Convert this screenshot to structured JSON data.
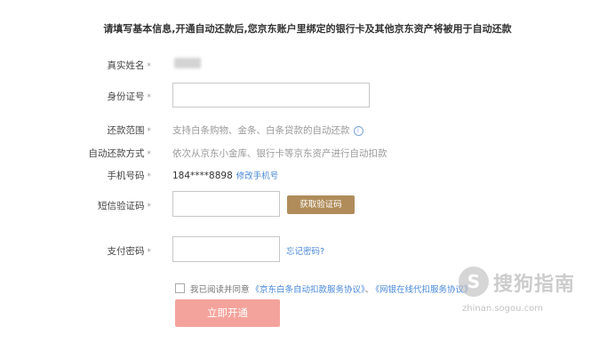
{
  "notice": "请填写基本信息,开通自动还款后,您京东账户里绑定的银行卡及其他京东资产将被用于自动还款",
  "form": {
    "name_label": "真实姓名",
    "id_label": "身份证号",
    "id_value": "",
    "scope_label": "还款范围",
    "scope_text": "支持白条购物、金条、白条贷款的自动还款",
    "scope_info": "i",
    "method_label": "自动还款方式",
    "method_text": "依次从京东小金库、银行卡等京东资产进行自动扣款",
    "phone_label": "手机号码",
    "phone_value": "184****8898",
    "change_phone": "修改手机号",
    "sms_label": "短信验证码",
    "sms_value": "",
    "sms_button": "获取验证码",
    "pay_label": "支付密码",
    "pay_value": "",
    "forgot": "忘记密码?",
    "star": "*"
  },
  "agreement": {
    "prefix": "我已阅读并同意",
    "link1": "《京东白条自动扣款服务协议》",
    "sep": "、",
    "link2": "《网银在线代扣服务协议》"
  },
  "submit": "立即开通",
  "watermark": {
    "logo": "S",
    "text": "搜狗指南",
    "url": "zhinan.sogou.com"
  },
  "colors": {
    "accent_gold": "#b08c5a",
    "submit_pink": "#f4a39c",
    "link_blue": "#4a88d8"
  }
}
